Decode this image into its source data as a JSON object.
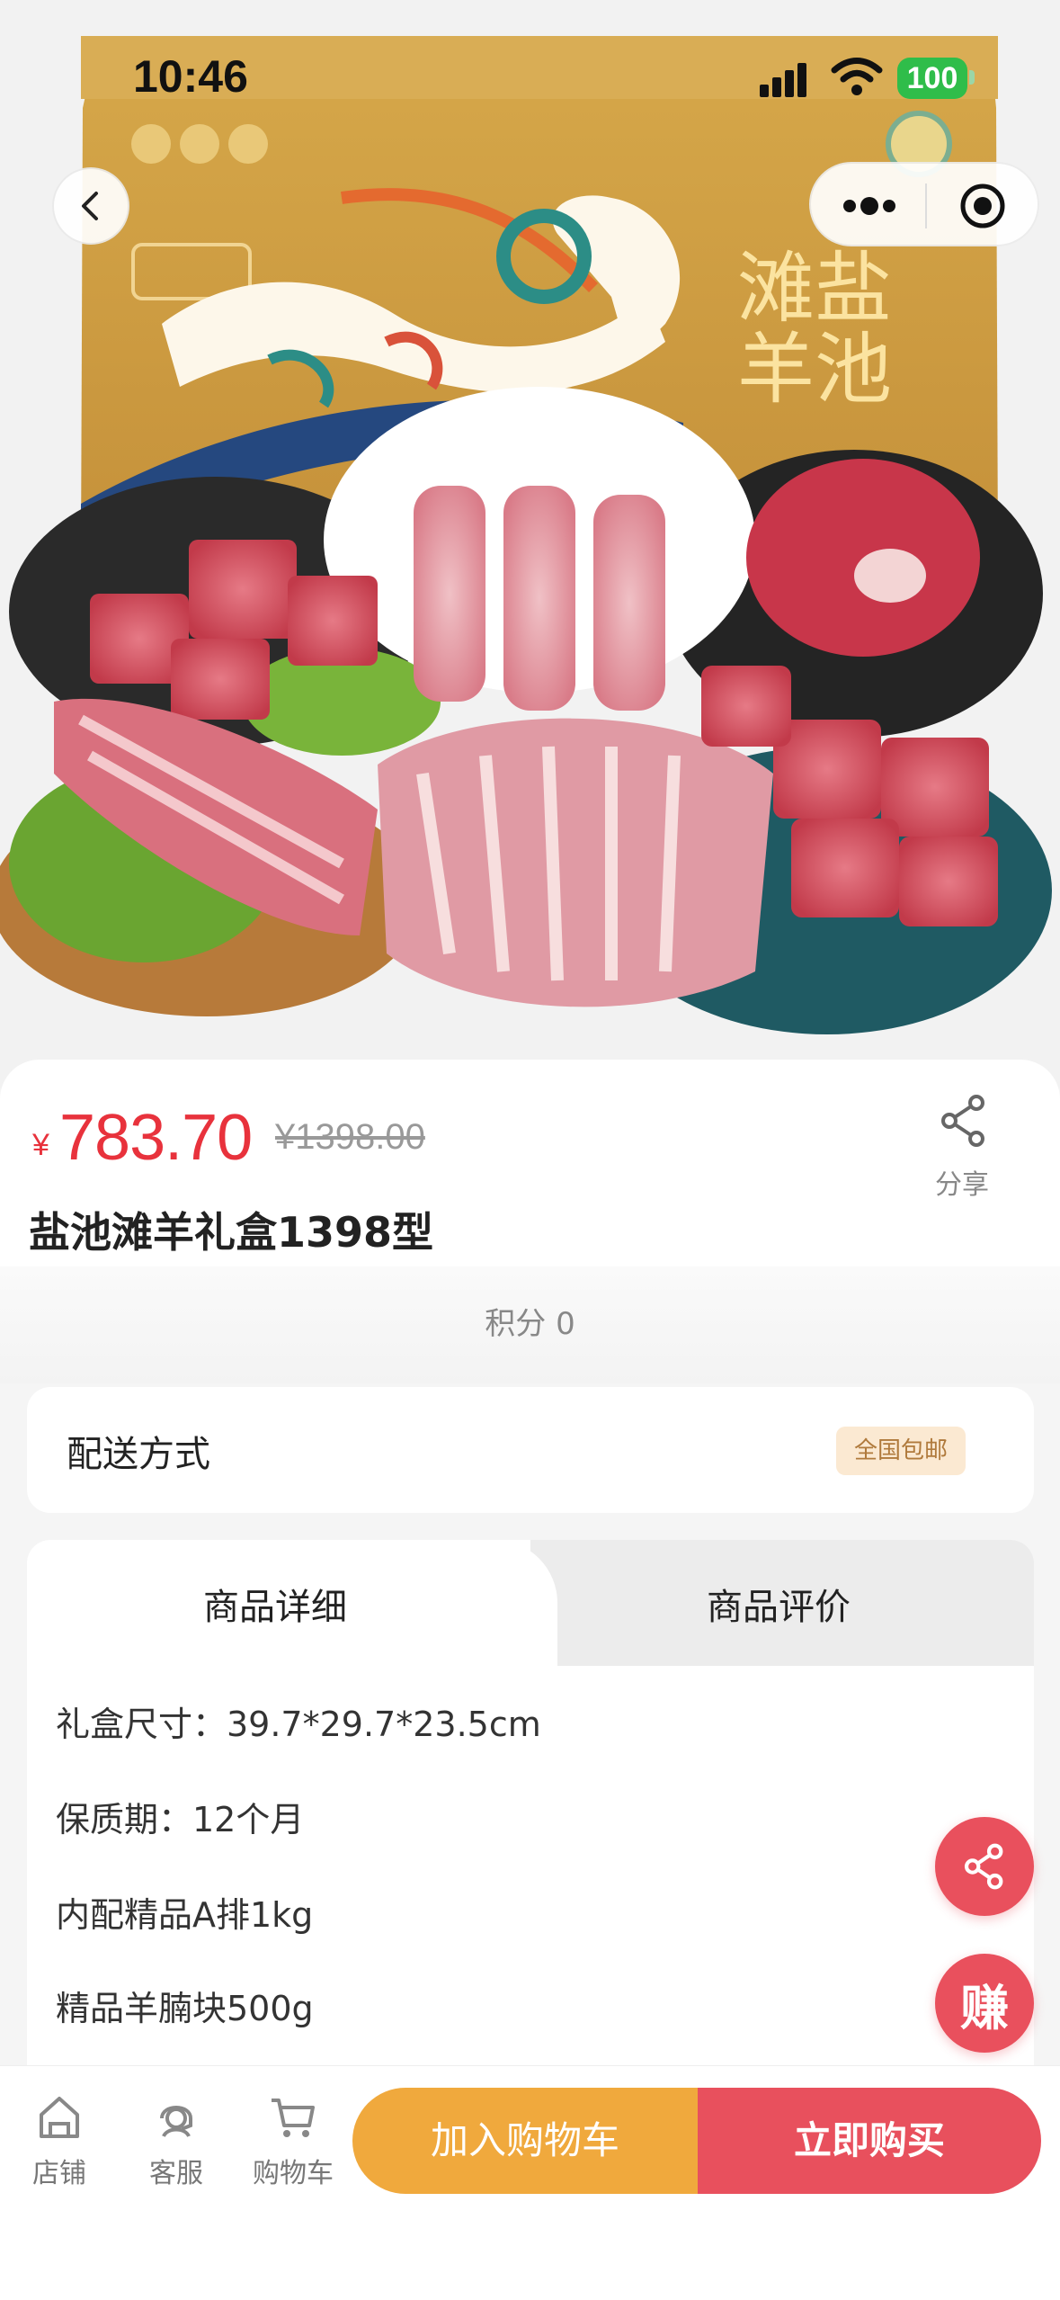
{
  "status_bar": {
    "time": "10:46",
    "battery": "100"
  },
  "product": {
    "currency_symbol": "¥",
    "price": "783.70",
    "original_price": "¥1398.00",
    "title": "盐池滩羊礼盒1398型",
    "points": "积分 0",
    "share_label": "分享"
  },
  "hero": {
    "brand_text_1": "滩盐",
    "brand_text_2": "羊池"
  },
  "delivery": {
    "label": "配送方式",
    "badge": "全国包邮"
  },
  "tabs": [
    {
      "label": "商品详细",
      "active": true
    },
    {
      "label": "商品评价",
      "active": false
    }
  ],
  "details": [
    "礼盒尺寸：39.7*29.7*23.5cm",
    "保质期：12个月",
    "内配精品A排1kg",
    "精品羊腩块500g"
  ],
  "fab": {
    "earn_label": "赚"
  },
  "bottom_bar": {
    "nav": [
      {
        "label": "店铺",
        "icon": "store-icon"
      },
      {
        "label": "客服",
        "icon": "customer-service-icon"
      },
      {
        "label": "购物车",
        "icon": "cart-icon"
      }
    ],
    "add_to_cart": "加入购物车",
    "buy_now": "立即购买"
  },
  "colors": {
    "accent_red": "#e8323c",
    "buy_red": "#e8505d",
    "cart_orange": "#f0a93d",
    "badge_bg": "#fbe9d2"
  }
}
